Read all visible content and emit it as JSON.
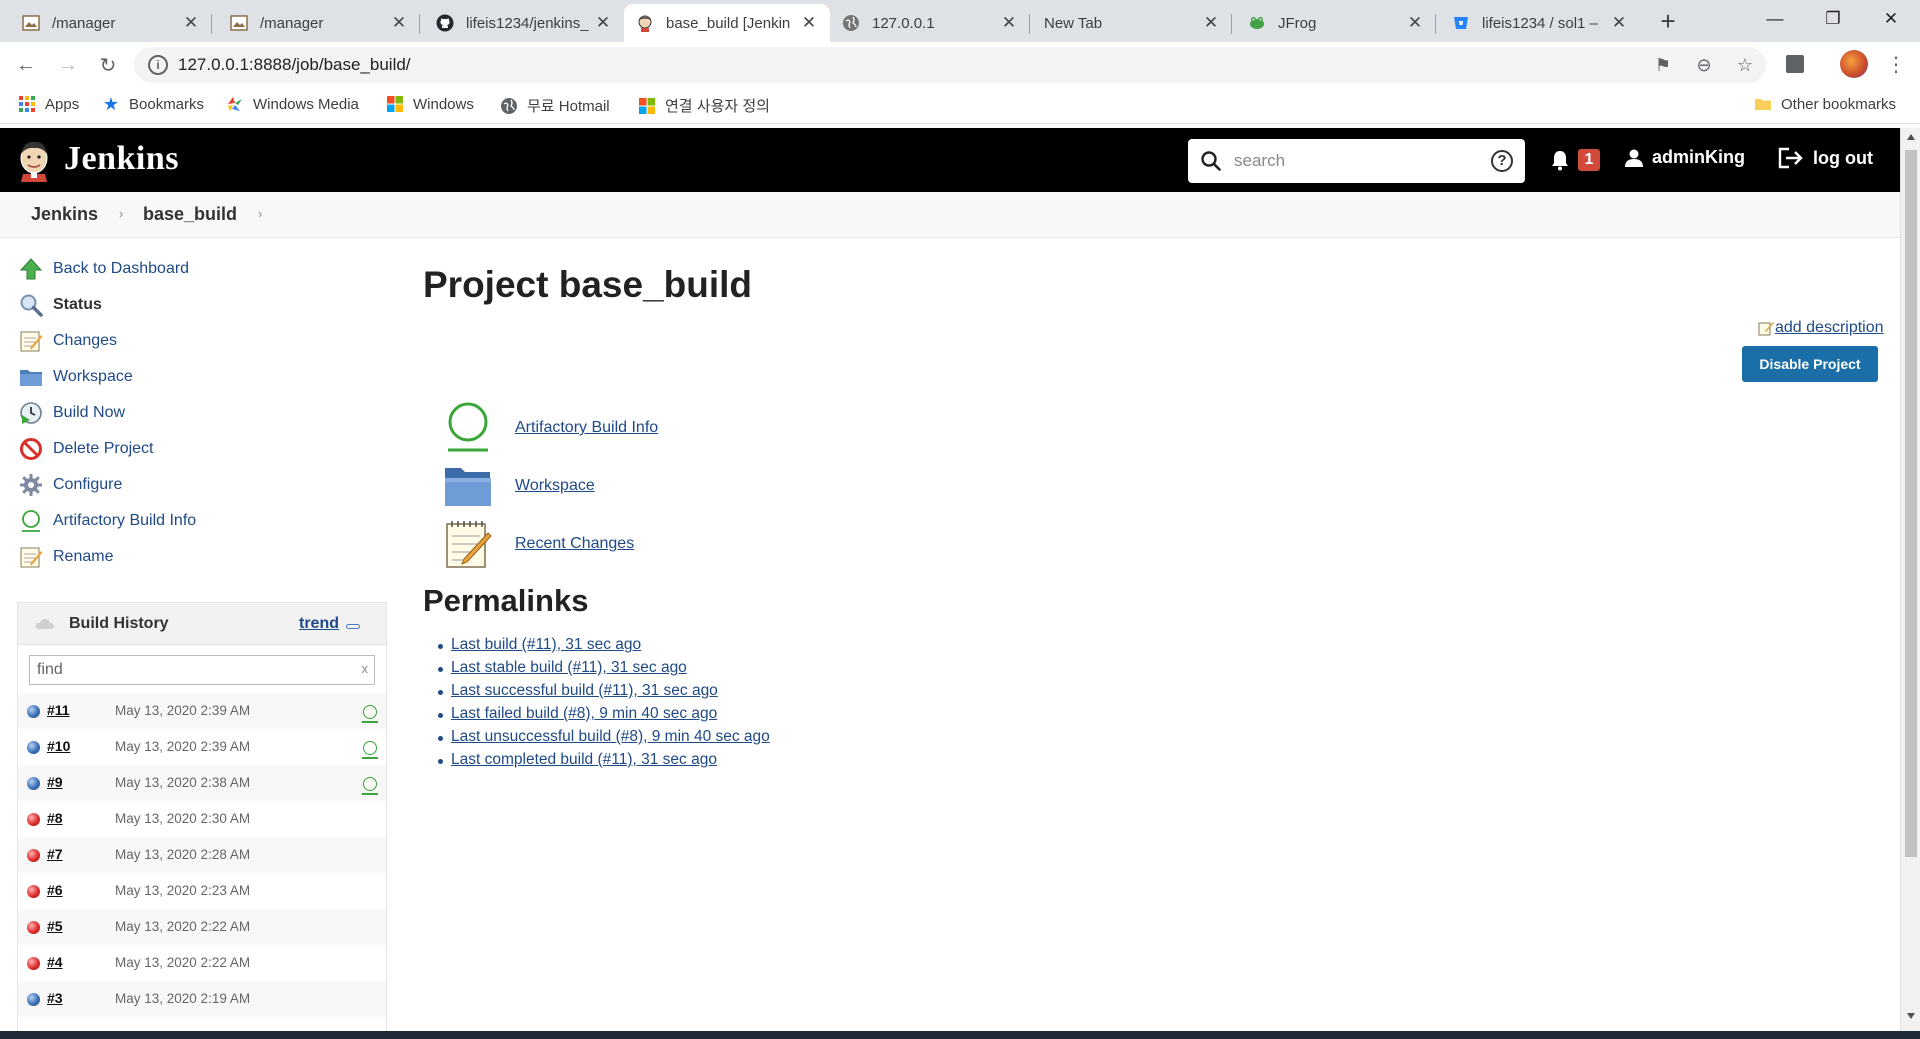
{
  "browser": {
    "tabs": [
      {
        "title": "/manager",
        "icon": "image-icon"
      },
      {
        "title": "/manager",
        "icon": "image-icon"
      },
      {
        "title": "lifeis1234/jenkins_",
        "icon": "github-icon"
      },
      {
        "title": "base_build [Jenkin",
        "icon": "jenkins-icon"
      },
      {
        "title": "127.0.0.1",
        "icon": "globe-icon"
      },
      {
        "title": "New Tab",
        "icon": ""
      },
      {
        "title": "JFrog",
        "icon": "jfrog-icon"
      },
      {
        "title": "lifeis1234 / sol1 –",
        "icon": "bitbucket-icon"
      }
    ],
    "active_tab": 3,
    "url": "127.0.0.1:8888/job/base_build/",
    "bookmarks": [
      {
        "label": "Apps",
        "icon": "apps-grid-icon"
      },
      {
        "label": "Bookmarks",
        "icon": "star-icon"
      },
      {
        "label": "Windows Media",
        "icon": "windows-media-icon"
      },
      {
        "label": "Windows",
        "icon": "windows-logo-icon"
      },
      {
        "label": "무료 Hotmail",
        "icon": "globe-icon"
      },
      {
        "label": "연결 사용자 정의",
        "icon": "windows-logo-icon"
      }
    ],
    "other_bookmarks": "Other bookmarks"
  },
  "header": {
    "brand": "Jenkins",
    "search_placeholder": "search",
    "notification_count": "1",
    "username": "adminKing",
    "logout_label": "log out"
  },
  "breadcrumb": [
    "Jenkins",
    "base_build"
  ],
  "sidebar": {
    "tasks": [
      {
        "label": "Back to Dashboard",
        "icon": "up-arrow-icon"
      },
      {
        "label": "Status",
        "icon": "magnifier-icon",
        "bold": true
      },
      {
        "label": "Changes",
        "icon": "notepad-icon"
      },
      {
        "label": "Workspace",
        "icon": "folder-icon"
      },
      {
        "label": "Build Now",
        "icon": "clock-play-icon"
      },
      {
        "label": "Delete Project",
        "icon": "no-entry-icon"
      },
      {
        "label": "Configure",
        "icon": "gear-icon"
      },
      {
        "label": "Artifactory Build Info",
        "icon": "artifactory-icon"
      },
      {
        "label": "Rename",
        "icon": "notepad-icon"
      }
    ]
  },
  "build_history": {
    "title": "Build History",
    "trend_label": "trend",
    "find_placeholder": "find",
    "clear_label": "x",
    "builds": [
      {
        "number": "#11",
        "date": "May 13, 2020 2:39 AM",
        "status": "blue",
        "artifactory": true
      },
      {
        "number": "#10",
        "date": "May 13, 2020 2:39 AM",
        "status": "blue",
        "artifactory": true
      },
      {
        "number": "#9",
        "date": "May 13, 2020 2:38 AM",
        "status": "blue",
        "artifactory": true
      },
      {
        "number": "#8",
        "date": "May 13, 2020 2:30 AM",
        "status": "red",
        "artifactory": false
      },
      {
        "number": "#7",
        "date": "May 13, 2020 2:28 AM",
        "status": "red",
        "artifactory": false
      },
      {
        "number": "#6",
        "date": "May 13, 2020 2:23 AM",
        "status": "red",
        "artifactory": false
      },
      {
        "number": "#5",
        "date": "May 13, 2020 2:22 AM",
        "status": "red",
        "artifactory": false
      },
      {
        "number": "#4",
        "date": "May 13, 2020 2:22 AM",
        "status": "red",
        "artifactory": false
      },
      {
        "number": "#3",
        "date": "May 13, 2020 2:19 AM",
        "status": "blue",
        "artifactory": false
      }
    ]
  },
  "main": {
    "title": "Project base_build",
    "add_description": "add description",
    "disable_button": "Disable Project",
    "links": [
      {
        "label": "Artifactory Build Info",
        "icon": "artifactory-icon"
      },
      {
        "label": "Workspace",
        "icon": "folder-icon"
      },
      {
        "label": "Recent Changes",
        "icon": "notepad-icon"
      }
    ],
    "permalinks_title": "Permalinks",
    "permalinks": [
      "Last build (#11), 31 sec ago",
      "Last stable build (#11), 31 sec ago",
      "Last successful build (#11), 31 sec ago",
      "Last failed build (#8), 9 min 40 sec ago",
      "Last unsuccessful build (#8), 9 min 40 sec ago",
      "Last completed build (#11), 31 sec ago"
    ]
  },
  "colors": {
    "header_bg": "#000000",
    "link": "#204a87",
    "button": "#1b6fa8",
    "badge": "#d24939",
    "success_ball": "#3b6fb8",
    "failure_ball": "#e02b2b",
    "artifactory_green": "#3aa63a"
  }
}
